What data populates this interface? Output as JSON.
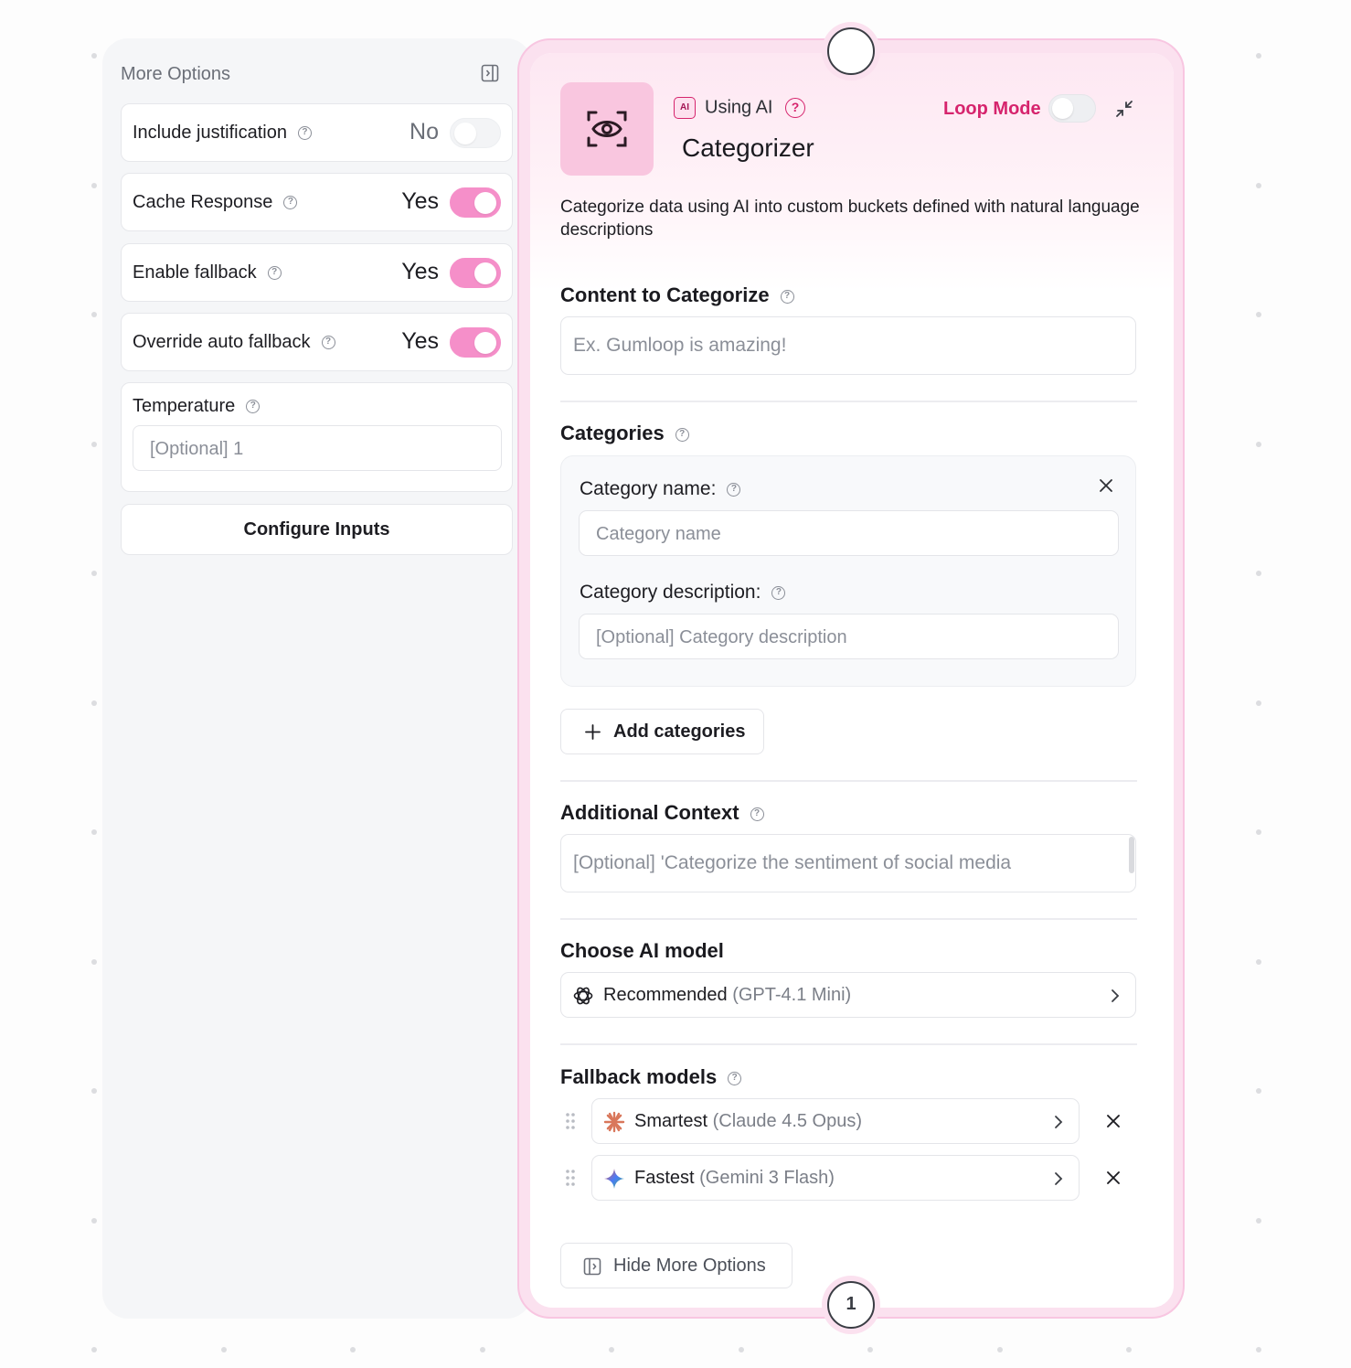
{
  "more_options": {
    "title": "More Options",
    "rows": [
      {
        "label": "Include justification",
        "value": "No",
        "on": false
      },
      {
        "label": "Cache Response",
        "value": "Yes",
        "on": true
      },
      {
        "label": "Enable fallback",
        "value": "Yes",
        "on": true
      },
      {
        "label": "Override auto fallback",
        "value": "Yes",
        "on": true
      }
    ],
    "temperature": {
      "label": "Temperature",
      "placeholder": "[Optional] 1"
    },
    "configure_label": "Configure Inputs"
  },
  "node": {
    "input_handle_label": "",
    "output_handle_label": "1",
    "using_ai_label": "Using AI",
    "ai_chip_label": "AI",
    "title": "Categorizer",
    "loop_mode_label": "Loop Mode",
    "loop_mode_on": false,
    "description": "Categorize data using AI into custom buckets defined with natural language descriptions",
    "content": {
      "title": "Content to Categorize",
      "placeholder": "Ex. Gumloop is amazing!"
    },
    "categories": {
      "title": "Categories",
      "name_label": "Category name:",
      "name_placeholder": "Category name",
      "description_label": "Category description:",
      "description_placeholder": "[Optional] Category description",
      "add_label": "Add categories"
    },
    "additional_context": {
      "title": "Additional Context",
      "placeholder": "[Optional] 'Categorize the sentiment of social media"
    },
    "model": {
      "title": "Choose AI model",
      "name": "Recommended",
      "detail": "(GPT-4.1 Mini)",
      "icon": "openai-icon"
    },
    "fallback": {
      "title": "Fallback models",
      "models": [
        {
          "name": "Smartest",
          "detail": "(Claude 4.5 Opus)",
          "icon": "claude-icon",
          "color": "#d9775b"
        },
        {
          "name": "Fastest",
          "detail": "(Gemini 3 Flash)",
          "icon": "gemini-icon",
          "color": "#4a7bf7"
        }
      ]
    },
    "hide_more_label": "Hide More Options"
  },
  "colors": {
    "accent": "#f58fc9",
    "brand": "#d6246d",
    "node_border": "#f8c6e1"
  }
}
